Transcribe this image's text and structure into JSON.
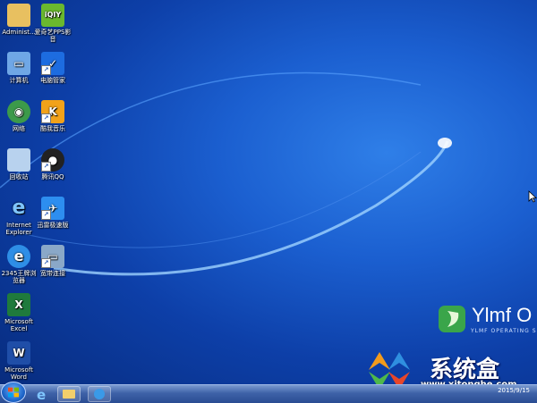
{
  "desktop_icons": [
    {
      "label": "Administ..."
    },
    {
      "label": "爱奇艺PPS影音"
    },
    {
      "label": "计算机"
    },
    {
      "label": "电脑管家"
    },
    {
      "label": "网络"
    },
    {
      "label": "酷我音乐"
    },
    {
      "label": "回收站"
    },
    {
      "label": "腾讯QQ"
    },
    {
      "label": "Internet Explorer"
    },
    {
      "label": "迅雷极速版"
    },
    {
      "label": "2345王牌浏览器"
    },
    {
      "label": "宽带连接"
    },
    {
      "label": "Microsoft Excel"
    },
    {
      "label": "Microsoft Word"
    }
  ],
  "brand": {
    "name": "Ylmf O",
    "subtitle": "YLMF OPERATING S"
  },
  "watermark": {
    "text": "系统盒",
    "url": "www.xitonghe.com"
  },
  "taskbar": {
    "clock": "2015/9/15"
  },
  "colors": {
    "wallpaper": "#1b5fd0",
    "taskbar": "#3e62a8"
  }
}
